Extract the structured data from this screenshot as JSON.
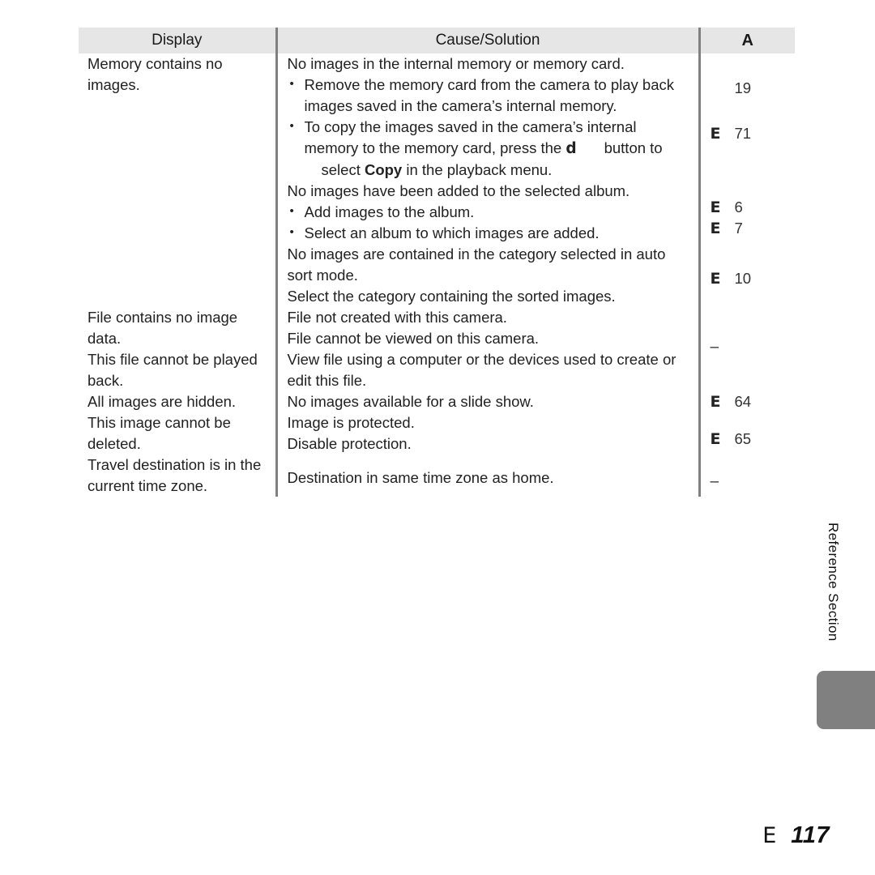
{
  "document": {
    "side_tab_label": "Reference Section",
    "footer": {
      "symbol": "E",
      "page_number": "117"
    }
  },
  "table": {
    "headers": {
      "display": "Display",
      "cause_solution": "Cause/Solution",
      "reference": "A"
    },
    "rows": [
      {
        "display": "Memory contains no images.",
        "cause_intro": "No images in the internal memory or memory card.",
        "bullets": [
          "Remove the memory card from the camera to play back images saved in the camera’s internal memory.",
          "To copy the images saved in the camera’s internal memory to the memory card, press the"
        ],
        "bullet2_icon": "d",
        "bullet2_tail": "button to",
        "bullet2_line3_pre": "select ",
        "bullet2_line3_bold": "Copy",
        "bullet2_line3_post": " in the playback menu.",
        "refs": [
          {
            "symbol": "",
            "number": "19"
          },
          {
            "symbol": "E",
            "number": "71"
          }
        ]
      },
      {
        "cause_intro": "No images have been added to the selected album.",
        "bullets": [
          "Add images to the album.",
          "Select an album to which images are added."
        ],
        "refs": [
          {
            "symbol": "E",
            "number": "6"
          },
          {
            "symbol": "E",
            "number": "7"
          }
        ]
      },
      {
        "cause_lines": [
          "No images are contained in the category selected in auto sort mode.",
          "Select the category containing the sorted images."
        ],
        "refs": [
          {
            "symbol": "E",
            "number": "10"
          }
        ]
      },
      {
        "display": "File contains no image data.",
        "cause_lines": [
          "File not created with this camera.",
          "File cannot be viewed on this camera."
        ],
        "refs": [
          {
            "symbol": "",
            "number": "–"
          }
        ]
      },
      {
        "display": "This file cannot be played back.",
        "cause_lines": [
          "View file using a computer or the devices used to create or edit this file."
        ]
      },
      {
        "display": "All images are hidden.",
        "cause_lines": [
          "No images available for a slide show."
        ],
        "refs": [
          {
            "symbol": "E",
            "number": "64"
          }
        ]
      },
      {
        "display": "This image cannot be deleted.",
        "cause_lines": [
          "Image is protected.",
          "Disable protection."
        ],
        "refs": [
          {
            "symbol": "E",
            "number": "65"
          }
        ]
      },
      {
        "display": "Travel destination is in the current time zone.",
        "cause_lines": [
          "Destination in same time zone as home."
        ],
        "refs": [
          {
            "symbol": "",
            "number": "–"
          }
        ]
      }
    ]
  }
}
